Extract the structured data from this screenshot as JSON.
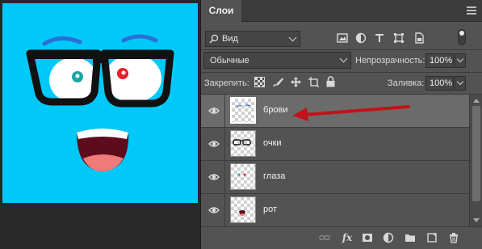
{
  "canvas": {
    "background": "#00c8f8",
    "image": "face-illustration"
  },
  "layers_panel": {
    "tab_label": "Слои",
    "filter": {
      "label": "Вид",
      "search_icon": "search-icon"
    },
    "filter_icons": [
      "pixel-layer-icon",
      "adjustment-layer-icon",
      "type-layer-icon",
      "shape-layer-icon",
      "smart-object-icon"
    ],
    "blend_mode": "Обычные",
    "opacity_label": "Непрозрачность:",
    "opacity_value": "100%",
    "lock_label": "Закрепить:",
    "lock_icons": [
      "lock-transparency-icon",
      "lock-image-icon",
      "lock-position-icon",
      "lock-artboard-icon",
      "lock-all-icon"
    ],
    "fill_label": "Заливка:",
    "fill_value": "100%",
    "layers": [
      {
        "name": "брови",
        "selected": true,
        "thumb": "eyebrows"
      },
      {
        "name": "очки",
        "selected": false,
        "thumb": "glasses"
      },
      {
        "name": "глаза",
        "selected": false,
        "thumb": "eyes"
      },
      {
        "name": "рот",
        "selected": false,
        "thumb": "mouth"
      }
    ],
    "footer_icons": [
      "link-layers-icon",
      "fx-icon",
      "add-mask-icon",
      "adjustment-icon",
      "new-group-icon",
      "new-layer-icon",
      "trash-icon"
    ],
    "fx_label": "fx"
  },
  "annotation": {
    "arrow_color": "#c0131a"
  }
}
